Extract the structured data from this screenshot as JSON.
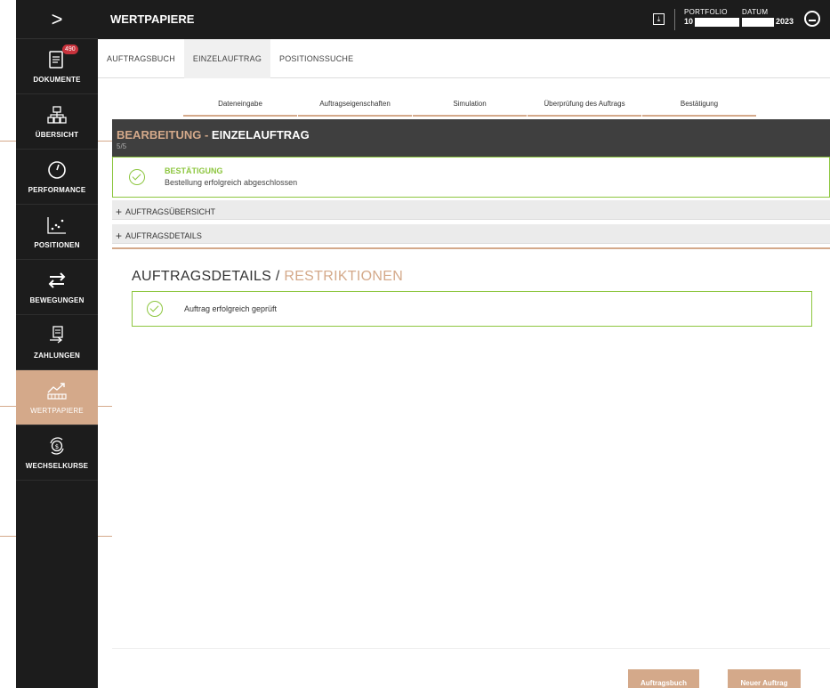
{
  "sidebar": {
    "toggle": ">",
    "badge": "490",
    "items": [
      {
        "label": "DOKUMENTE",
        "icon": "document-icon"
      },
      {
        "label": "ÜBERSICHT",
        "icon": "hierarchy-icon"
      },
      {
        "label": "PERFORMANCE",
        "icon": "gauge-icon"
      },
      {
        "label": "POSITIONEN",
        "icon": "scatter-chart-icon"
      },
      {
        "label": "BEWEGUNGEN",
        "icon": "transfer-arrows-icon"
      },
      {
        "label": "ZAHLUNGEN",
        "icon": "payment-icon"
      },
      {
        "label": "WERTPAPIERE",
        "icon": "securities-chart-icon"
      },
      {
        "label": "WECHSELKURSE",
        "icon": "currency-exchange-icon"
      }
    ]
  },
  "topbar": {
    "title": "WERTPAPIERE",
    "portfolio_label": "PORTFOLIO",
    "portfolio_value": "10",
    "date_label": "DATUM",
    "date_value": "2023"
  },
  "tabs": [
    "AUFTRAGSBUCH",
    "EINZELAUFTRAG",
    "POSITIONSSUCHE"
  ],
  "steps": [
    "Dateneingabe",
    "Auftragseigenschaften",
    "Simulation",
    "Überprüfung des Auftrags",
    "Bestätigung"
  ],
  "header": {
    "accent": "BEARBEITUNG",
    "separator": " - ",
    "title": "EINZELAUFTRAG",
    "step_counter": "5/5"
  },
  "confirmation": {
    "title": "BESTÄTIGUNG",
    "message": "Bestellung erfolgreich abgeschlossen"
  },
  "accordions": [
    "AUFTRAGSÜBERSICHT",
    "AUFTRAGSDETAILS"
  ],
  "section": {
    "title": "AUFTRAGSDETAILS / ",
    "accent": "RESTRIKTIONEN",
    "check_message": "Auftrag erfolgreich geprüft"
  },
  "buttons": {
    "order_book": "Auftragsbuch",
    "new_order": "Neuer Auftrag"
  },
  "colors": {
    "accent": "#d4a98a",
    "success": "#8dc63f",
    "dark": "#1c1c1c"
  }
}
